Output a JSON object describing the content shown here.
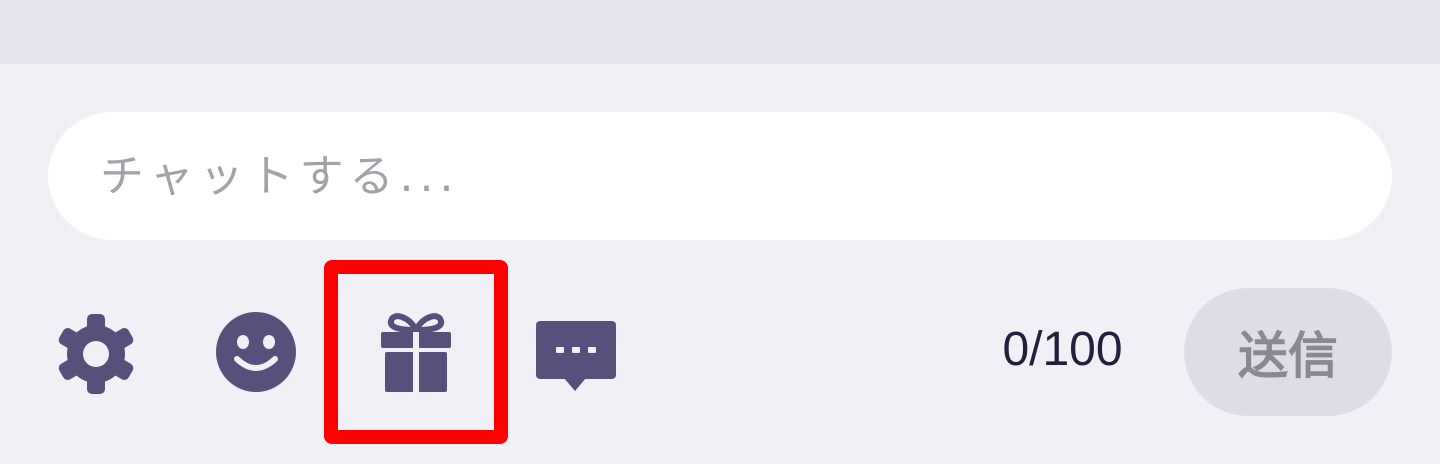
{
  "chat": {
    "placeholder": "チャットする...",
    "value": ""
  },
  "toolbar": {
    "icons": [
      "gear-icon",
      "smiley-icon",
      "gift-icon",
      "speech-bubble-icon"
    ],
    "highlight_color": "#ff0000",
    "icon_color": "#56507a"
  },
  "counter": {
    "text": "0/100"
  },
  "send": {
    "label": "送信"
  }
}
